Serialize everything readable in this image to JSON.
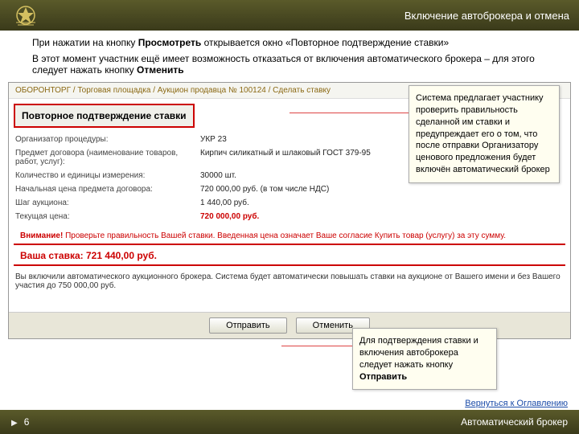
{
  "header": {
    "title": "Включение автоброкера и отмена"
  },
  "para1_a": "При нажатии на кнопку ",
  "para1_b": "Просмотреть",
  "para1_c": " открывается окно «Повторное подтверждение ставки»",
  "para2_a": "В этот момент участник ещё имеет возможность отказаться от включения автоматического брокера – для этого следует нажать кнопку ",
  "para2_b": "Отменить",
  "shot": {
    "breadcrumb": "ОБОРОНТОРГ / Торговая площадка / Аукцион продавца № 100124 / Сделать ставку",
    "section_title": "Повторное подтверждение ставки",
    "rows": [
      {
        "label": "Организатор процедуры:",
        "value": "УКР 23"
      },
      {
        "label": "Предмет договора (наименование товаров, работ, услуг):",
        "value": "Кирпич силикатный и шлаковый ГОСТ 379-95"
      },
      {
        "label": "Количество и единицы измерения:",
        "value": "30000 шт."
      },
      {
        "label": "Начальная цена предмета договора:",
        "value": "720 000,00 руб. (в том числе НДС)"
      },
      {
        "label": "Шаг аукциона:",
        "value": "1 440,00 руб."
      },
      {
        "label": "Текущая цена:",
        "value": "720 000,00 руб."
      }
    ],
    "warning_b": "Внимание!",
    "warning": " Проверьте правильность Вашей ставки. Введенная цена означает Ваше согласие Купить товар (услугу) за эту сумму.",
    "bid_label": "Ваша ставка: ",
    "bid_value": "721 440,00 руб.",
    "auto_note": "Вы включили автоматического аукционного брокера. Система будет автоматически повышать ставки на аукционе от Вашего имени и без Вашего участия до 750 000,00 руб.",
    "btn_send": "Отправить",
    "btn_cancel": "Отменить"
  },
  "callout1_a": "Система предлагает участнику проверить правильность сделанной им ставки и предупреждает его о том, что после отправки Организатору  ценового предложения  будет включён автоматический брокер",
  "callout2_a": "Для подтверждения ставки и включения автоброкера следует нажать кнопку ",
  "callout2_b": "Отправить",
  "return_link": "Вернуться к Оглавлению",
  "footer": {
    "page": "6",
    "title": "Автоматический брокер"
  }
}
